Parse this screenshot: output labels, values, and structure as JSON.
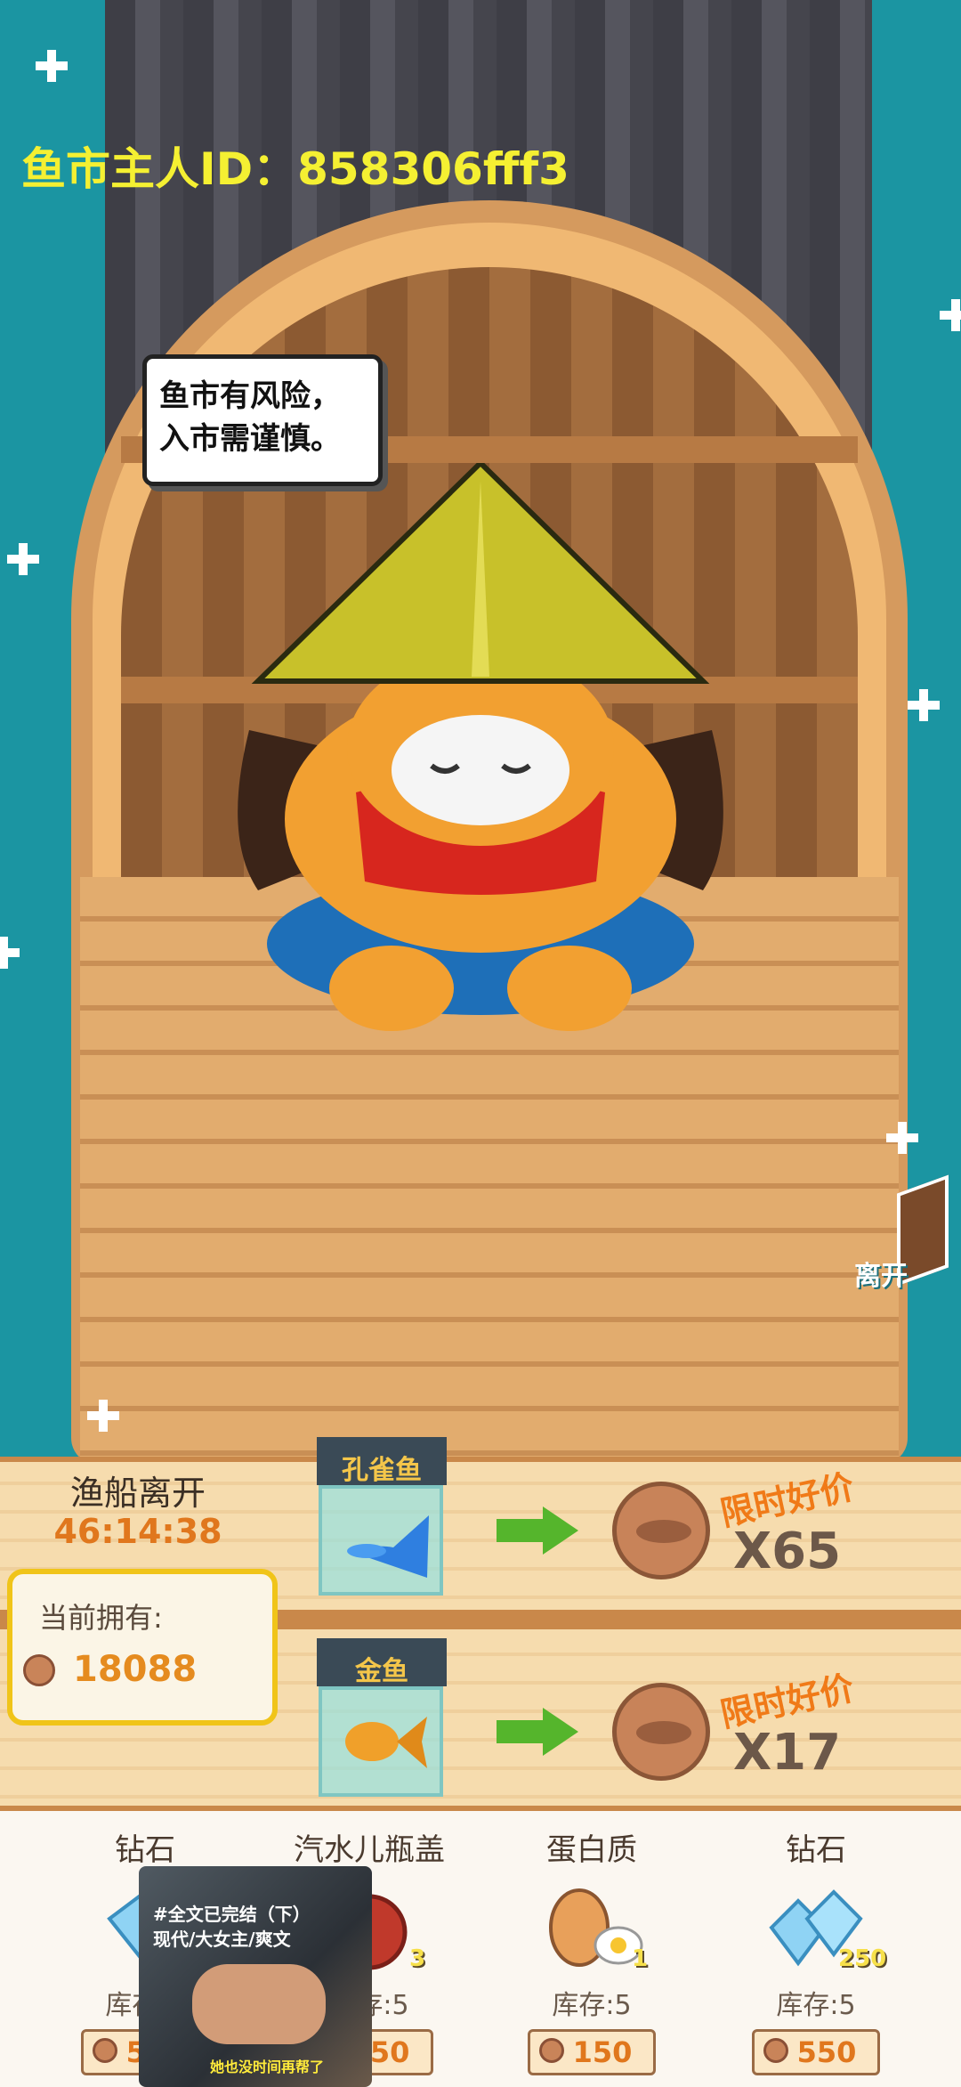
{
  "header": {
    "owner_id": "鱼市主人ID：858306fff3"
  },
  "npc": {
    "speech_line1": "鱼市有风险，",
    "speech_line2": "入市需谨慎。"
  },
  "actions": {
    "leave_label": "离开"
  },
  "shop": {
    "depart_label": "渔船离开",
    "depart_timer": "46:14:38",
    "owned_label": "当前拥有:",
    "owned_value": "18088",
    "offers": [
      {
        "fish": "孔雀鱼",
        "promo": "限时好价",
        "quantity": "X65"
      },
      {
        "fish": "金鱼",
        "promo": "限时好价",
        "quantity": "X17"
      }
    ]
  },
  "items": [
    {
      "name": "钻石",
      "badge": "",
      "stock": "库存:5",
      "price": "550"
    },
    {
      "name": "汽水儿瓶盖",
      "badge": "3",
      "stock": "库存:5",
      "price": "150"
    },
    {
      "name": "蛋白质",
      "badge": "1",
      "stock": "库存:5",
      "price": "150"
    },
    {
      "name": "钻石",
      "badge": "250",
      "stock": "库存:5",
      "price": "550"
    }
  ],
  "video": {
    "title_line1": "#全文已完结（下）",
    "title_line2": "现代/大女主/爽文",
    "caption": "她也没时间再帮了"
  },
  "colors": {
    "water": "#1b95a2",
    "accent_orange": "#e0771d",
    "owner_text": "#f5f032"
  }
}
